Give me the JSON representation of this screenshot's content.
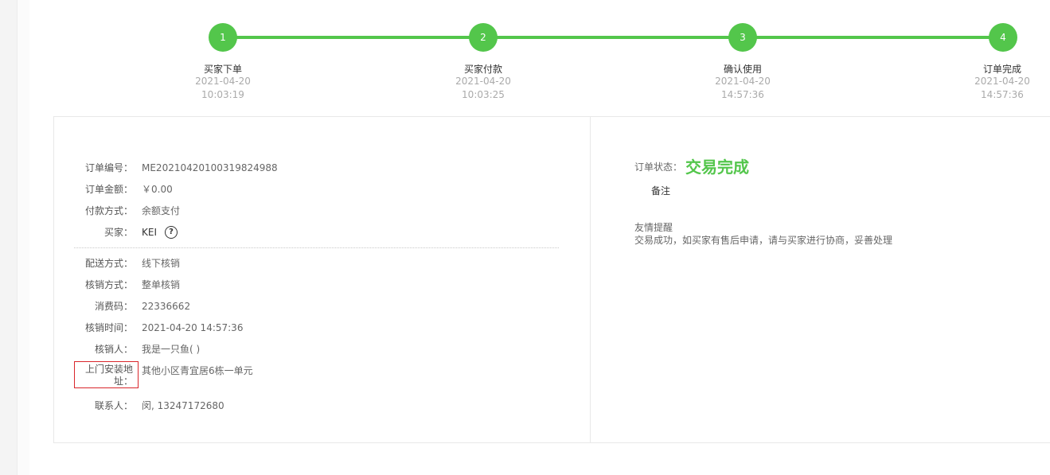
{
  "progress": {
    "steps": [
      {
        "num": "1",
        "label": "买家下单",
        "date": "2021-04-20",
        "time": "10:03:19"
      },
      {
        "num": "2",
        "label": "买家付款",
        "date": "2021-04-20",
        "time": "10:03:25"
      },
      {
        "num": "3",
        "label": "确认使用",
        "date": "2021-04-20",
        "time": "14:57:36"
      },
      {
        "num": "4",
        "label": "订单完成",
        "date": "2021-04-20",
        "time": "14:57:36"
      }
    ],
    "color": "#53c64b"
  },
  "order": {
    "number": {
      "label": "订单编号：",
      "value": "ME20210420100319824988"
    },
    "amount": {
      "label": "订单金额：",
      "value": "￥0.00"
    },
    "payment": {
      "label": "付款方式：",
      "value": "余额支付"
    },
    "buyer": {
      "label": "买家：",
      "value": "KEI",
      "help_icon": "question-circle-icon"
    },
    "delivery": {
      "label": "配送方式：",
      "value": "线下核销"
    },
    "verify_method": {
      "label": "核销方式：",
      "value": "整单核销"
    },
    "code": {
      "label": "消费码：",
      "value": "22336662"
    },
    "verify_time": {
      "label": "核销时间：",
      "value": "2021-04-20 14:57:36"
    },
    "verifier": {
      "label": "核销人：",
      "value": "我是一只鱼( )"
    },
    "address": {
      "label": "上门安装地址：",
      "value": "其他小区青宜居6栋一单元"
    },
    "contact": {
      "label": "联系人：",
      "value": "闵, 13247172680"
    }
  },
  "status": {
    "label": "订单状态：",
    "value": "交易完成",
    "note": "备注",
    "tip_title": "友情提醒",
    "tip_text": "交易成功，如买家有售后申请，请与买家进行协商，妥善处理",
    "highlight_color": "#53c64b"
  }
}
